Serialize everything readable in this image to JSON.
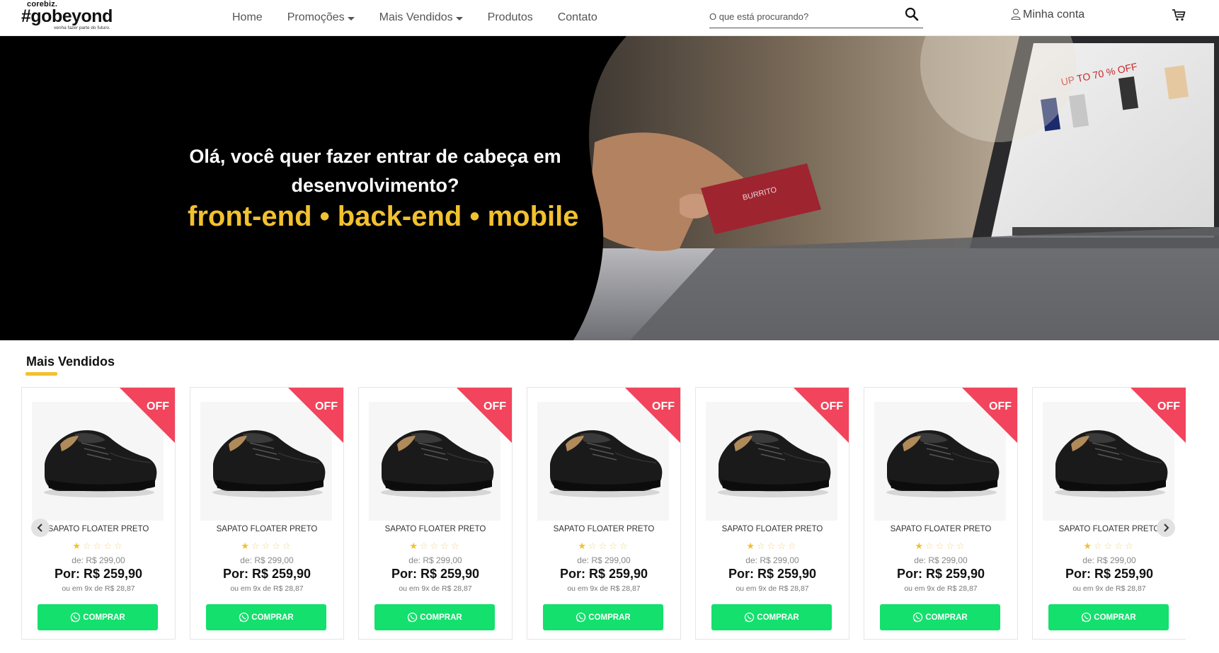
{
  "brand": {
    "top": "corebiz.",
    "main": "#gobeyond",
    "tagline": "venha fazer parte do futuro."
  },
  "nav": [
    {
      "label": "Home",
      "has_caret": false
    },
    {
      "label": "Promoções",
      "has_caret": true
    },
    {
      "label": "Mais Vendidos",
      "has_caret": true
    },
    {
      "label": "Produtos",
      "has_caret": false
    },
    {
      "label": "Contato",
      "has_caret": false
    }
  ],
  "search": {
    "placeholder": "O que está procurando?",
    "value": ""
  },
  "account": {
    "label": "Minha conta"
  },
  "banner": {
    "title": "Olá, você quer fazer entrar de cabeça em desenvolvimento?",
    "tech": "front-end • back-end • mobile"
  },
  "section": {
    "title": "Mais Vendidos"
  },
  "products": [
    {
      "badge": "OFF",
      "name": "SAPATO FLOATER PRETO",
      "rating": 1,
      "old_price": "de: R$ 299,00",
      "price": "Por: R$ 259,90",
      "installments": "ou em 9x de R$ 28,87",
      "buy_label": "COMPRAR"
    },
    {
      "badge": "OFF",
      "name": "SAPATO FLOATER PRETO",
      "rating": 1,
      "old_price": "de: R$ 299,00",
      "price": "Por: R$ 259,90",
      "installments": "ou em 9x de R$ 28,87",
      "buy_label": "COMPRAR"
    },
    {
      "badge": "OFF",
      "name": "SAPATO FLOATER PRETO",
      "rating": 1,
      "old_price": "de: R$ 299,00",
      "price": "Por: R$ 259,90",
      "installments": "ou em 9x de R$ 28,87",
      "buy_label": "COMPRAR"
    },
    {
      "badge": "OFF",
      "name": "SAPATO FLOATER PRETO",
      "rating": 1,
      "old_price": "de: R$ 299,00",
      "price": "Por: R$ 259,90",
      "installments": "ou em 9x de R$ 28,87",
      "buy_label": "COMPRAR"
    },
    {
      "badge": "OFF",
      "name": "SAPATO FLOATER PRETO",
      "rating": 1,
      "old_price": "de: R$ 299,00",
      "price": "Por: R$ 259,90",
      "installments": "ou em 9x de R$ 28,87",
      "buy_label": "COMPRAR"
    },
    {
      "badge": "OFF",
      "name": "SAPATO FLOATER PRETO",
      "rating": 1,
      "old_price": "de: R$ 299,00",
      "price": "Por: R$ 259,90",
      "installments": "ou em 9x de R$ 28,87",
      "buy_label": "COMPRAR"
    },
    {
      "badge": "OFF",
      "name": "SAPATO FLOATER PRETO",
      "rating": 1,
      "old_price": "de: R$ 299,00",
      "price": "Por: R$ 259,90",
      "installments": "ou em 9x de R$ 28,87",
      "buy_label": "COMPRAR"
    }
  ],
  "colors": {
    "accent": "#f2c12e",
    "badge": "#f2445c",
    "buy": "#13e06d"
  },
  "icons": {
    "search": "search-icon",
    "user": "user-icon",
    "cart": "cart-icon",
    "whatsapp": "whatsapp-icon",
    "prev": "chevron-left-icon",
    "next": "chevron-right-icon"
  }
}
